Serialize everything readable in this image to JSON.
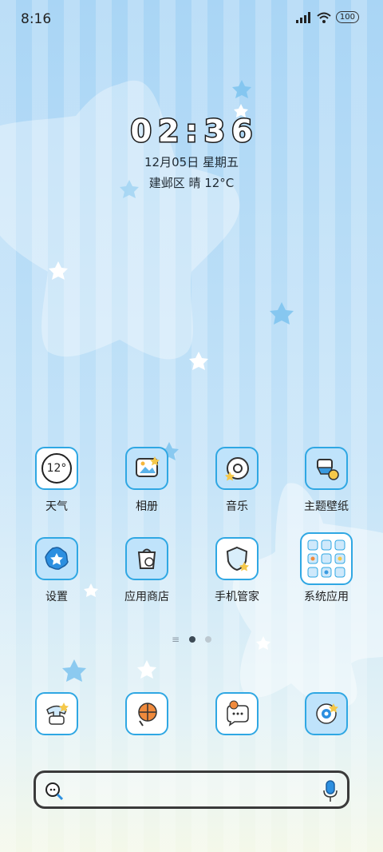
{
  "status_bar": {
    "time": "8:16",
    "battery": "100",
    "icons": [
      "signal-icon",
      "wifi-icon",
      "battery-icon"
    ]
  },
  "clock_widget": {
    "digits": [
      "0",
      "2",
      ":",
      "3",
      "6"
    ],
    "date": "12月05日 星期五",
    "location_weather": "建邺区 晴 12°C"
  },
  "apps": [
    {
      "label": "天气",
      "icon": "weather-icon",
      "badge": "12°"
    },
    {
      "label": "相册",
      "icon": "gallery-icon"
    },
    {
      "label": "音乐",
      "icon": "music-icon"
    },
    {
      "label": "主题壁纸",
      "icon": "theme-icon"
    },
    {
      "label": "设置",
      "icon": "settings-icon"
    },
    {
      "label": "应用商店",
      "icon": "app-store-icon"
    },
    {
      "label": "手机管家",
      "icon": "security-icon"
    },
    {
      "label": "系统应用",
      "icon": "system-apps-folder-icon"
    }
  ],
  "page_indicator": {
    "pages": 2,
    "current": 1
  },
  "dock": [
    {
      "icon": "phone-icon"
    },
    {
      "icon": "browser-icon"
    },
    {
      "icon": "messages-icon"
    },
    {
      "icon": "camera-icon"
    }
  ],
  "search_bar": {
    "left_icon": "search-icon",
    "right_icon": "microphone-icon"
  },
  "colors": {
    "accent": "#2fa7e3",
    "icon_fill_blue": "#bfe3fb",
    "text": "#1e1e1e"
  }
}
